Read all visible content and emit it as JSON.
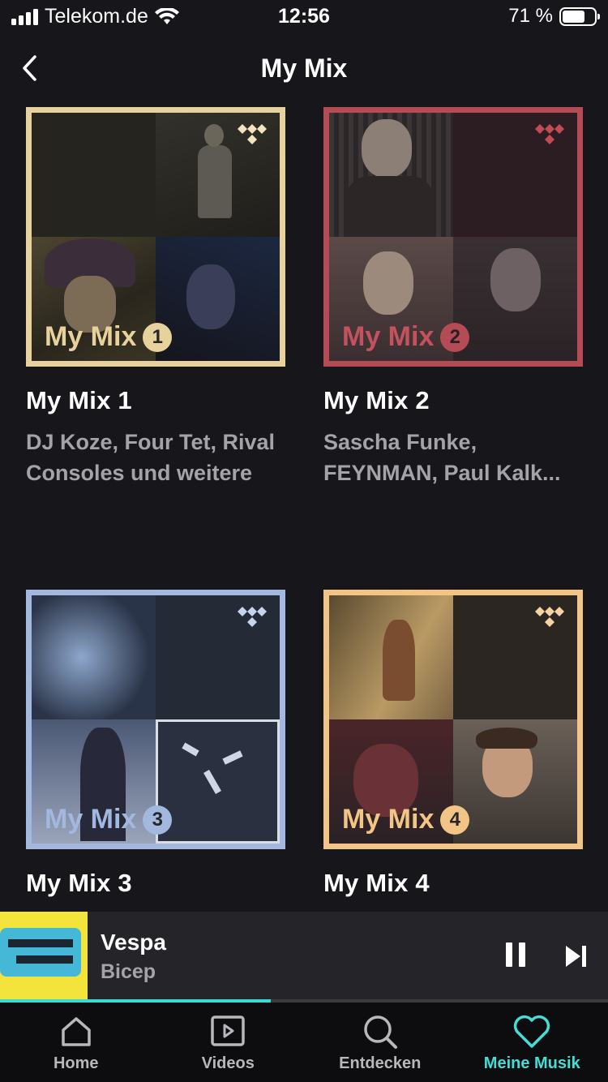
{
  "status_bar": {
    "carrier": "Telekom.de",
    "time": "12:56",
    "battery": "71 %"
  },
  "header": {
    "title": "My Mix"
  },
  "mixes": [
    {
      "cover_label": "My Mix",
      "number": "1",
      "title": "My Mix 1",
      "subtitle": "DJ Koze, Four Tet, Rival Consoles und weitere",
      "accent": "#e7d29e"
    },
    {
      "cover_label": "My Mix",
      "number": "2",
      "title": "My Mix 2",
      "subtitle": "Sascha Funke, FEYNMAN, Paul Kalk...",
      "accent": "#b54b55"
    },
    {
      "cover_label": "My Mix",
      "number": "3",
      "title": "My Mix 3",
      "subtitle": "",
      "accent": "#a2b8df"
    },
    {
      "cover_label": "My Mix",
      "number": "4",
      "title": "My Mix 4",
      "subtitle": "",
      "accent": "#f2c486"
    }
  ],
  "player": {
    "title": "Vespa",
    "artist": "Bicep",
    "progress": 0.445
  },
  "tabs": [
    {
      "label": "Home",
      "icon": "home-icon"
    },
    {
      "label": "Videos",
      "icon": "video-icon"
    },
    {
      "label": "Entdecken",
      "icon": "search-icon"
    },
    {
      "label": "Meine Musik",
      "icon": "heart-icon",
      "active": true
    }
  ],
  "colors": {
    "background": "#17171b",
    "accent": "#45ddd4"
  }
}
